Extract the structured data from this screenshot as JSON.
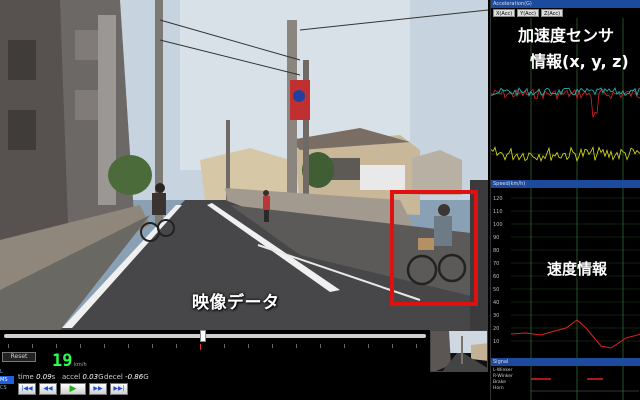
{
  "video": {
    "caption": "映像データ",
    "detection_color": "#e01010"
  },
  "timeline": {
    "progress": 0.47
  },
  "controls": {
    "reset_label": "Reset",
    "speed_value": "19",
    "speed_unit": "km/h",
    "side_labels": [
      "L",
      "MS",
      "CS"
    ],
    "time_label": "time",
    "time_value": "0.09",
    "time_unit": "s",
    "accel_label": "accel",
    "accel_value": "0.03",
    "accel_unit": "G",
    "dec_label": "decel",
    "dec_value": "-0.86",
    "dec_unit": "G",
    "buttons": [
      {
        "name": "skip-start",
        "glyph": "|◀◀"
      },
      {
        "name": "step-back",
        "glyph": "◀◀"
      },
      {
        "name": "play",
        "glyph": "▶"
      },
      {
        "name": "step-forward",
        "glyph": "▶▶"
      },
      {
        "name": "skip-end",
        "glyph": "▶▶|"
      }
    ]
  },
  "accel_panel": {
    "title": "Acceleration(G)",
    "toolbar": [
      "X(Acc)",
      "Y(Acc)",
      "Z(Acc)"
    ],
    "overlay_line1": "加速度センサ",
    "overlay_line2": "情報(x, y, z)",
    "series_colors": [
      "#e02020",
      "#20c0c0",
      "#e0e020"
    ]
  },
  "speed_panel": {
    "title": "Speed(km/h)",
    "overlay": "速度情報",
    "line_color": "#e02020",
    "y_ticks": [
      "120",
      "110",
      "100",
      "90",
      "80",
      "70",
      "60",
      "50",
      "40",
      "30",
      "20",
      "10"
    ]
  },
  "signal_panel": {
    "title": "Signal",
    "labels": [
      "L-Winker",
      "R-Winker",
      "Brake",
      "Horn"
    ]
  },
  "colors": {
    "panel_title_bg": "#1c4a9c",
    "speed_digits": "#2cff50"
  }
}
